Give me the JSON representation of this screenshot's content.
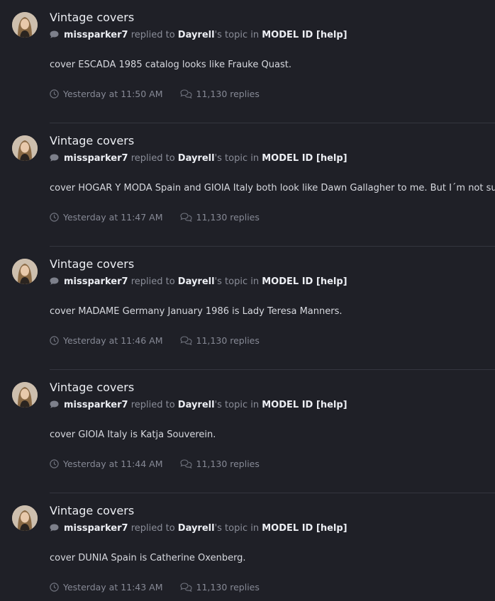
{
  "activity": {
    "entries": [
      {
        "title": "Vintage covers",
        "author": "missparker7",
        "replied_to_text": "replied to",
        "topic_owner": "Dayrell",
        "topic_suffix": "'s topic in",
        "forum": "MODEL ID [help]",
        "body": "cover ESCADA 1985 catalog looks like Frauke Quast.",
        "time": "Yesterday at 11:50 AM",
        "replies": "11,130 replies"
      },
      {
        "title": "Vintage covers",
        "author": "missparker7",
        "replied_to_text": "replied to",
        "topic_owner": "Dayrell",
        "topic_suffix": "'s topic in",
        "forum": "MODEL ID [help]",
        "body": "cover HOGAR Y MODA Spain and GIOIA Italy both look like Dawn Gallagher to me. But I´m not sure.",
        "time": "Yesterday at 11:47 AM",
        "replies": "11,130 replies"
      },
      {
        "title": "Vintage covers",
        "author": "missparker7",
        "replied_to_text": "replied to",
        "topic_owner": "Dayrell",
        "topic_suffix": "'s topic in",
        "forum": "MODEL ID [help]",
        "body": "cover MADAME Germany January 1986 is Lady Teresa Manners.",
        "time": "Yesterday at 11:46 AM",
        "replies": "11,130 replies"
      },
      {
        "title": "Vintage covers",
        "author": "missparker7",
        "replied_to_text": "replied to",
        "topic_owner": "Dayrell",
        "topic_suffix": "'s topic in",
        "forum": "MODEL ID [help]",
        "body": "cover GIOIA Italy is Katja Souverein.",
        "time": "Yesterday at 11:44 AM",
        "replies": "11,130 replies"
      },
      {
        "title": "Vintage covers",
        "author": "missparker7",
        "replied_to_text": "replied to",
        "topic_owner": "Dayrell",
        "topic_suffix": "'s topic in",
        "forum": "MODEL ID [help]",
        "body": "cover DUNIA Spain is Catherine Oxenberg.",
        "time": "Yesterday at 11:43 AM",
        "replies": "11,130 replies"
      }
    ]
  },
  "icons": {
    "reply_type": "comment-bubble-icon",
    "time": "clock-icon",
    "replies": "comments-icon"
  },
  "colors": {
    "background": "#1f2027",
    "title": "#eceef3",
    "muted": "#8a8d98",
    "separator": "#34363f"
  }
}
